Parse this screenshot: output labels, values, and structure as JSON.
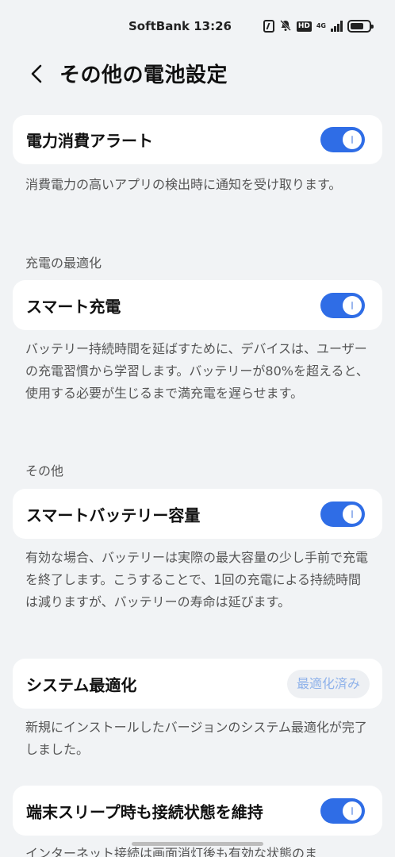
{
  "status_bar": {
    "carrier_time": "SoftBank 13:26",
    "icons": [
      "nfc-icon",
      "mute-icon",
      "hd-icon",
      "network-4g-icon",
      "signal-icon",
      "battery-icon"
    ],
    "hd_label": "HD",
    "network_label": "4G"
  },
  "header": {
    "back_icon": "chevron-left-icon",
    "title": "その他の電池設定"
  },
  "power_alert": {
    "label": "電力消費アラート",
    "enabled": true,
    "description": "消費電力の高いアプリの検出時に通知を受け取ります。"
  },
  "charging_section": {
    "title": "充電の最適化",
    "smart_charge": {
      "label": "スマート充電",
      "enabled": true,
      "description": "バッテリー持続時間を延ばすために、デバイスは、ユーザーの充電習慣から学習します。バッテリーが80%を超えると、使用する必要が生じるまで満充電を遅らせます。"
    }
  },
  "other_section": {
    "title": "その他",
    "smart_capacity": {
      "label": "スマートバッテリー容量",
      "enabled": true,
      "description": "有効な場合、バッテリーは実際の最大容量の少し手前で充電を終了します。こうすることで、1回の充電による持続時間は減りますが、バッテリーの寿命は延びます。"
    },
    "system_optimize": {
      "label": "システム最適化",
      "button_label": "最適化済み",
      "description": "新規にインストールしたバージョンのシステム最適化が完了しました。"
    },
    "keep_connected": {
      "label": "端末スリープ時も接続状態を維持",
      "enabled": true,
      "description": "インターネット接続は画面消灯後も有効な状態のま"
    }
  },
  "colors": {
    "accent": "#2f6de6",
    "background": "#f1f3f5",
    "card": "#ffffff",
    "disabled_text": "#8fb2ea"
  }
}
